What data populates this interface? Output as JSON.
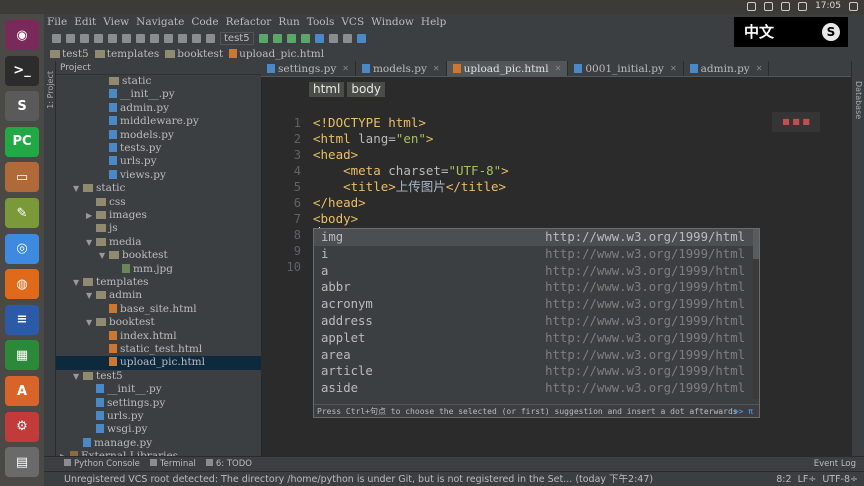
{
  "topbar": {
    "time": "17:05"
  },
  "ime": {
    "label": "中文",
    "logo": "S"
  },
  "launcher": [
    {
      "name": "ubuntu-dash",
      "color": "#7a2a5a",
      "glyph": "◉"
    },
    {
      "name": "terminal",
      "color": "#2c2c2c",
      "glyph": ">_"
    },
    {
      "name": "sublime",
      "color": "#5a5a5a",
      "glyph": "S"
    },
    {
      "name": "pycharm",
      "color": "#22a845",
      "glyph": "PC"
    },
    {
      "name": "files",
      "color": "#b06a3a",
      "glyph": "▭"
    },
    {
      "name": "editor",
      "color": "#7a9a3a",
      "glyph": "✎"
    },
    {
      "name": "chrome",
      "color": "#3d8ae0",
      "glyph": "◎"
    },
    {
      "name": "firefox",
      "color": "#e06a1a",
      "glyph": "◍"
    },
    {
      "name": "writer",
      "color": "#2a5aa8",
      "glyph": "≡"
    },
    {
      "name": "calc",
      "color": "#2a8a3a",
      "glyph": "▦"
    },
    {
      "name": "software",
      "color": "#d8642a",
      "glyph": "A"
    },
    {
      "name": "settings",
      "color": "#c23a3a",
      "glyph": "⚙"
    },
    {
      "name": "workspace",
      "color": "#6a6a6a",
      "glyph": "▤"
    }
  ],
  "menu": [
    "File",
    "Edit",
    "View",
    "Navigate",
    "Code",
    "Refactor",
    "Run",
    "Tools",
    "VCS",
    "Window",
    "Help"
  ],
  "toolbar": {
    "run_config": "test5"
  },
  "navbar": [
    "test5",
    "templates",
    "booktest",
    "upload_pic.html"
  ],
  "project": {
    "header": "Project",
    "side_label": "1: Project",
    "tree": [
      {
        "label": "static",
        "indent": 3,
        "kind": "dir",
        "arrow": ""
      },
      {
        "label": "__init__.py",
        "indent": 3,
        "kind": "py",
        "arrow": ""
      },
      {
        "label": "admin.py",
        "indent": 3,
        "kind": "py",
        "arrow": ""
      },
      {
        "label": "middleware.py",
        "indent": 3,
        "kind": "py",
        "arrow": ""
      },
      {
        "label": "models.py",
        "indent": 3,
        "kind": "py",
        "arrow": ""
      },
      {
        "label": "tests.py",
        "indent": 3,
        "kind": "py",
        "arrow": ""
      },
      {
        "label": "urls.py",
        "indent": 3,
        "kind": "py",
        "arrow": ""
      },
      {
        "label": "views.py",
        "indent": 3,
        "kind": "py",
        "arrow": ""
      },
      {
        "label": "static",
        "indent": 1,
        "kind": "dir",
        "arrow": "▼"
      },
      {
        "label": "css",
        "indent": 2,
        "kind": "dir",
        "arrow": ""
      },
      {
        "label": "images",
        "indent": 2,
        "kind": "dir",
        "arrow": "▶"
      },
      {
        "label": "js",
        "indent": 2,
        "kind": "dir",
        "arrow": ""
      },
      {
        "label": "media",
        "indent": 2,
        "kind": "dir",
        "arrow": "▼"
      },
      {
        "label": "booktest",
        "indent": 3,
        "kind": "dir",
        "arrow": "▼"
      },
      {
        "label": "mm.jpg",
        "indent": 4,
        "kind": "img",
        "arrow": ""
      },
      {
        "label": "templates",
        "indent": 1,
        "kind": "dir",
        "arrow": "▼"
      },
      {
        "label": "admin",
        "indent": 2,
        "kind": "dir",
        "arrow": "▼"
      },
      {
        "label": "base_site.html",
        "indent": 3,
        "kind": "ht",
        "arrow": ""
      },
      {
        "label": "booktest",
        "indent": 2,
        "kind": "dir",
        "arrow": "▼"
      },
      {
        "label": "index.html",
        "indent": 3,
        "kind": "ht",
        "arrow": ""
      },
      {
        "label": "static_test.html",
        "indent": 3,
        "kind": "ht",
        "arrow": ""
      },
      {
        "label": "upload_pic.html",
        "indent": 3,
        "kind": "ht",
        "arrow": "",
        "selected": true
      },
      {
        "label": "test5",
        "indent": 1,
        "kind": "dir",
        "arrow": "▼"
      },
      {
        "label": "__init__.py",
        "indent": 2,
        "kind": "py",
        "arrow": ""
      },
      {
        "label": "settings.py",
        "indent": 2,
        "kind": "py",
        "arrow": ""
      },
      {
        "label": "urls.py",
        "indent": 2,
        "kind": "py",
        "arrow": ""
      },
      {
        "label": "wsgi.py",
        "indent": 2,
        "kind": "py",
        "arrow": ""
      },
      {
        "label": "manage.py",
        "indent": 1,
        "kind": "py",
        "arrow": ""
      },
      {
        "label": "External Libraries",
        "indent": 0,
        "kind": "lib",
        "arrow": "▶"
      }
    ]
  },
  "tabs": [
    {
      "label": "settings.py",
      "active": false
    },
    {
      "label": "models.py",
      "active": false
    },
    {
      "label": "upload_pic.html",
      "active": true
    },
    {
      "label": "0001_initial.py",
      "active": false
    },
    {
      "label": "admin.py",
      "active": false
    }
  ],
  "breadcrumbs": [
    "html",
    "body"
  ],
  "code": [
    {
      "n": "1",
      "parts": [
        [
          "t",
          "<!DOCTYPE html>"
        ]
      ]
    },
    {
      "n": "2",
      "parts": [
        [
          "t",
          "<html "
        ],
        [
          "at",
          "lang="
        ],
        [
          "str",
          "\"en\""
        ],
        [
          "t",
          ">"
        ]
      ]
    },
    {
      "n": "3",
      "parts": [
        [
          "t",
          "<head>"
        ]
      ]
    },
    {
      "n": "4",
      "parts": [
        [
          "t",
          "    <meta "
        ],
        [
          "at",
          "charset="
        ],
        [
          "str",
          "\"UTF-8\""
        ],
        [
          "t",
          ">"
        ]
      ]
    },
    {
      "n": "5",
      "parts": [
        [
          "t",
          "    <title>"
        ],
        [
          "tx",
          "上传图片"
        ],
        [
          "t",
          "</title>"
        ]
      ]
    },
    {
      "n": "6",
      "parts": [
        [
          "t",
          "</head>"
        ]
      ]
    },
    {
      "n": "7",
      "parts": [
        [
          "t",
          "<body>"
        ]
      ]
    },
    {
      "n": "8",
      "parts": [
        [
          "t",
          "<"
        ]
      ]
    },
    {
      "n": "9",
      "parts": []
    },
    {
      "n": "10",
      "parts": []
    }
  ],
  "autocomplete": {
    "items": [
      {
        "name": "img",
        "url": "http://www.w3.org/1999/html",
        "selected": true
      },
      {
        "name": "i",
        "url": "http://www.w3.org/1999/html"
      },
      {
        "name": "a",
        "url": "http://www.w3.org/1999/html"
      },
      {
        "name": "abbr",
        "url": "http://www.w3.org/1999/html"
      },
      {
        "name": "acronym",
        "url": "http://www.w3.org/1999/html"
      },
      {
        "name": "address",
        "url": "http://www.w3.org/1999/html"
      },
      {
        "name": "applet",
        "url": "http://www.w3.org/1999/html"
      },
      {
        "name": "area",
        "url": "http://www.w3.org/1999/html"
      },
      {
        "name": "article",
        "url": "http://www.w3.org/1999/html"
      },
      {
        "name": "aside",
        "url": "http://www.w3.org/1999/html"
      }
    ],
    "hint": "Press Ctrl+句点 to choose the selected (or first) suggestion and insert a dot afterwards",
    "hint_link": ">> π"
  },
  "right_strip": "Database",
  "bottom_tabs": [
    "Python Console",
    "Terminal",
    "6: TODO"
  ],
  "event_log": "Event Log",
  "status": {
    "message": "Unregistered VCS root detected: The directory /home/python is under Git, but is not registered in the Set... (today 下午2:47)",
    "position": "8:2",
    "line_sep": "LF÷",
    "encoding": "UTF-8÷"
  }
}
